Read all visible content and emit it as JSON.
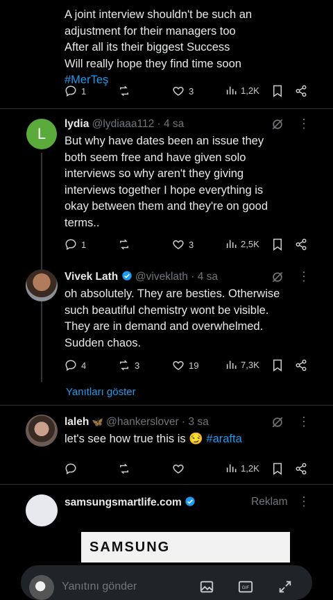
{
  "tweet0": {
    "lines": [
      "A joint interview shouldn't be such an",
      "adjustment for their managers too",
      "After all its their biggest Success",
      "Will really hope they find time soon"
    ],
    "hashtag": "#MerTeş",
    "replies": "1",
    "likes": "3",
    "views": "1,2K"
  },
  "tweet1": {
    "avatar_letter": "L",
    "name": "lydia",
    "handle": "@lydiaaa112 · 4 sa",
    "lines": [
      "But why have dates been an issue they",
      "both seem free and have given solo",
      "interviews so why aren't they giving",
      "interviews together I hope everything is",
      "okay between them and they're on good",
      "terms.."
    ],
    "replies": "1",
    "likes": "3",
    "views": "2,5K"
  },
  "tweet2": {
    "name": "Vivek Lath",
    "handle": "@viveklath · 4 sa",
    "lines": [
      "oh absolutely. They are besties. Otherwise",
      "such beautiful chemistry wont be visible.",
      "They are in demand and overwhelmed.",
      "Sudden chaos."
    ],
    "replies": "4",
    "retweets": "3",
    "likes": "19",
    "views": "7,3K"
  },
  "show_replies": "Yanıtları göster",
  "tweet3": {
    "name": "laleh",
    "name_emoji": "🦋",
    "handle": "@hankerslover · 3 sa",
    "text": "let's see how true this is",
    "emoji": "😏",
    "hashtag": "#arafta",
    "views": "1,2K"
  },
  "ad": {
    "name": "samsungsmartlife.com",
    "label": "Reklam",
    "brand": "SAMSUNG"
  },
  "composer": {
    "placeholder": "Yanıtını gönder"
  },
  "colors": {
    "accent": "#1d9bf0",
    "lydia_avatar": "#5bab3c",
    "muted": "#71767b"
  }
}
